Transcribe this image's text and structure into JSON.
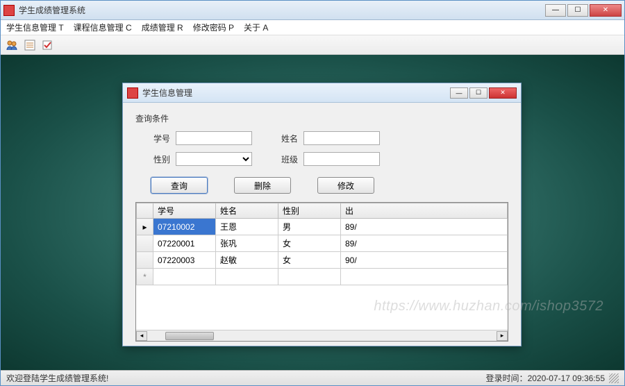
{
  "main": {
    "title": "学生成绩管理系统",
    "menu": [
      "学生信息管理 T",
      "课程信息管理 C",
      "成绩管理 R",
      "修改密码 P",
      "关于 A"
    ],
    "toolbarIcons": [
      "users-icon",
      "form-icon",
      "check-icon"
    ]
  },
  "dialog": {
    "title": "学生信息管理",
    "queryLabel": "查询条件",
    "fields": {
      "idLabel": "学号",
      "id": "",
      "nameLabel": "姓名",
      "name": "",
      "genderLabel": "性别",
      "gender": "",
      "classLabel": "班级",
      "class": ""
    },
    "buttons": {
      "query": "查询",
      "delete": "删除",
      "modify": "修改"
    },
    "grid": {
      "headers": [
        "学号",
        "姓名",
        "性别",
        "出"
      ],
      "rows": [
        {
          "id": "07210002",
          "name": "王恩",
          "gender": "男",
          "birth": "89/"
        },
        {
          "id": "07220001",
          "name": "张巩",
          "gender": "女",
          "birth": "89/"
        },
        {
          "id": "07220003",
          "name": "赵敏",
          "gender": "女",
          "birth": "90/"
        }
      ],
      "newRowMarker": "*",
      "currentRowMarker": "▸"
    }
  },
  "status": {
    "welcome": "欢迎登陆学生成绩管理系统!",
    "loginTimeLabel": "登录时间：",
    "loginTime": "2020-07-17 09:36:55"
  },
  "watermark": "https://www.huzhan.com/ishop3572"
}
